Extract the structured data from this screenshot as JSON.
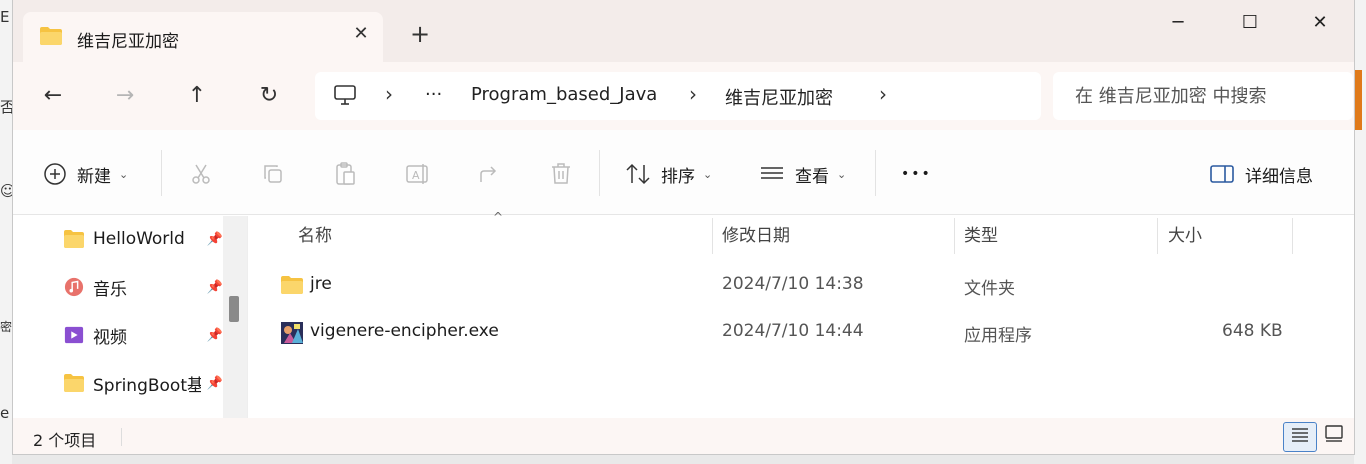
{
  "window": {
    "tab_title": "维吉尼亚加密",
    "new_tab": "+",
    "minimize": "─",
    "maximize": "☐",
    "close": "✕"
  },
  "nav": {
    "back": "←",
    "forward": "→",
    "up": "↑",
    "refresh": "↻"
  },
  "address": {
    "ellipsis": "···",
    "crumbs": [
      "Program_based_Java",
      "维吉尼亚加密"
    ],
    "separator": "›"
  },
  "search": {
    "placeholder": "在 维吉尼亚加密 中搜索"
  },
  "toolbar": {
    "new_label": "新建",
    "sort_label": "排序",
    "view_label": "查看",
    "more_label": "•••",
    "details_label": "详细信息"
  },
  "sidebar": {
    "items": [
      {
        "label": "HelloWorld",
        "icon": "folder-icon"
      },
      {
        "label": "音乐",
        "icon": "music-icon"
      },
      {
        "label": "视频",
        "icon": "video-icon"
      },
      {
        "label": "SpringBoot基",
        "icon": "folder-icon"
      }
    ]
  },
  "table": {
    "columns": [
      "名称",
      "修改日期",
      "类型",
      "大小"
    ],
    "rows": [
      {
        "name": "jre",
        "date": "2024/7/10 14:38",
        "type": "文件夹",
        "size": "",
        "icon": "folder-icon"
      },
      {
        "name": "vigenere-encipher.exe",
        "date": "2024/7/10 14:44",
        "type": "应用程序",
        "size": "648 KB",
        "icon": "exe-icon"
      }
    ]
  },
  "status": {
    "item_count": "2 个项目"
  },
  "colors": {
    "folder": "#f6c342",
    "accent": "#4a82c8",
    "titlebar": "#f3ecea"
  }
}
